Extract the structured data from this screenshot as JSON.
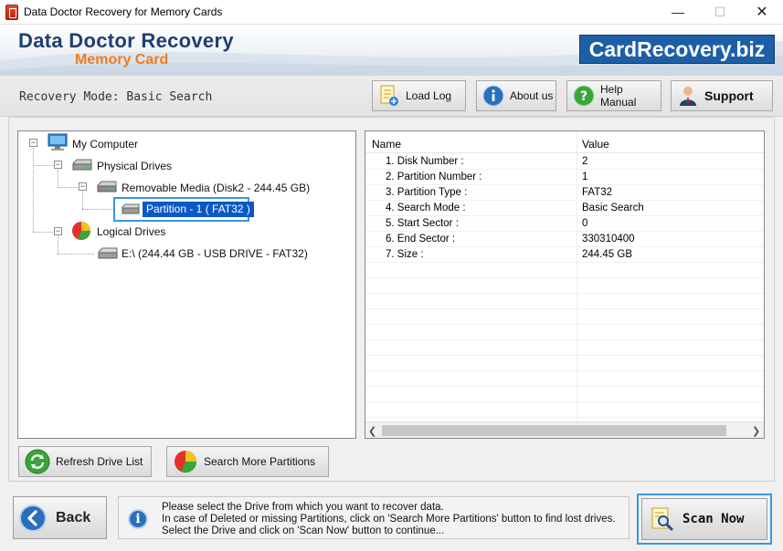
{
  "window": {
    "title": "Data Doctor Recovery for Memory Cards",
    "min": "—",
    "max": "☐",
    "close": "✕"
  },
  "banner": {
    "brand_title": "Data Doctor Recovery",
    "brand_subtitle": "Memory Card",
    "site": "CardRecovery.biz"
  },
  "toolbar": {
    "mode_label": "Recovery Mode: Basic Search",
    "load_log": "Load Log",
    "about_us": "About us",
    "help_manual": "Help Manual",
    "support": "Support"
  },
  "tree": {
    "root": "My Computer",
    "physical": "Physical Drives",
    "removable": "Removable Media (Disk2 - 244.45 GB)",
    "partition": "Partition - 1 ( FAT32 )",
    "logical": "Logical Drives",
    "drive_e": "E:\\ (244.44 GB - USB DRIVE - FAT32)"
  },
  "props": {
    "headers": {
      "name": "Name",
      "value": "Value"
    },
    "rows": [
      {
        "name": "1. Disk Number :",
        "value": "2"
      },
      {
        "name": "2. Partition Number :",
        "value": "1"
      },
      {
        "name": "3. Partition Type :",
        "value": "FAT32"
      },
      {
        "name": "4. Search Mode :",
        "value": "Basic Search"
      },
      {
        "name": "5. Start Sector :",
        "value": "0"
      },
      {
        "name": "6. End Sector :",
        "value": "330310400"
      },
      {
        "name": "7. Size :",
        "value": "244.45 GB"
      }
    ]
  },
  "buttons": {
    "refresh": "Refresh Drive List",
    "search_more": "Search More Partitions",
    "back": "Back",
    "scan_now": "Scan Now"
  },
  "info": {
    "line1": "Please select the Drive from which you want to recover data.",
    "line2": "In case of Deleted or missing Partitions, click on 'Search More Partitions' button to find lost drives.",
    "line3": "Select the Drive and click on 'Scan Now' button to continue..."
  }
}
